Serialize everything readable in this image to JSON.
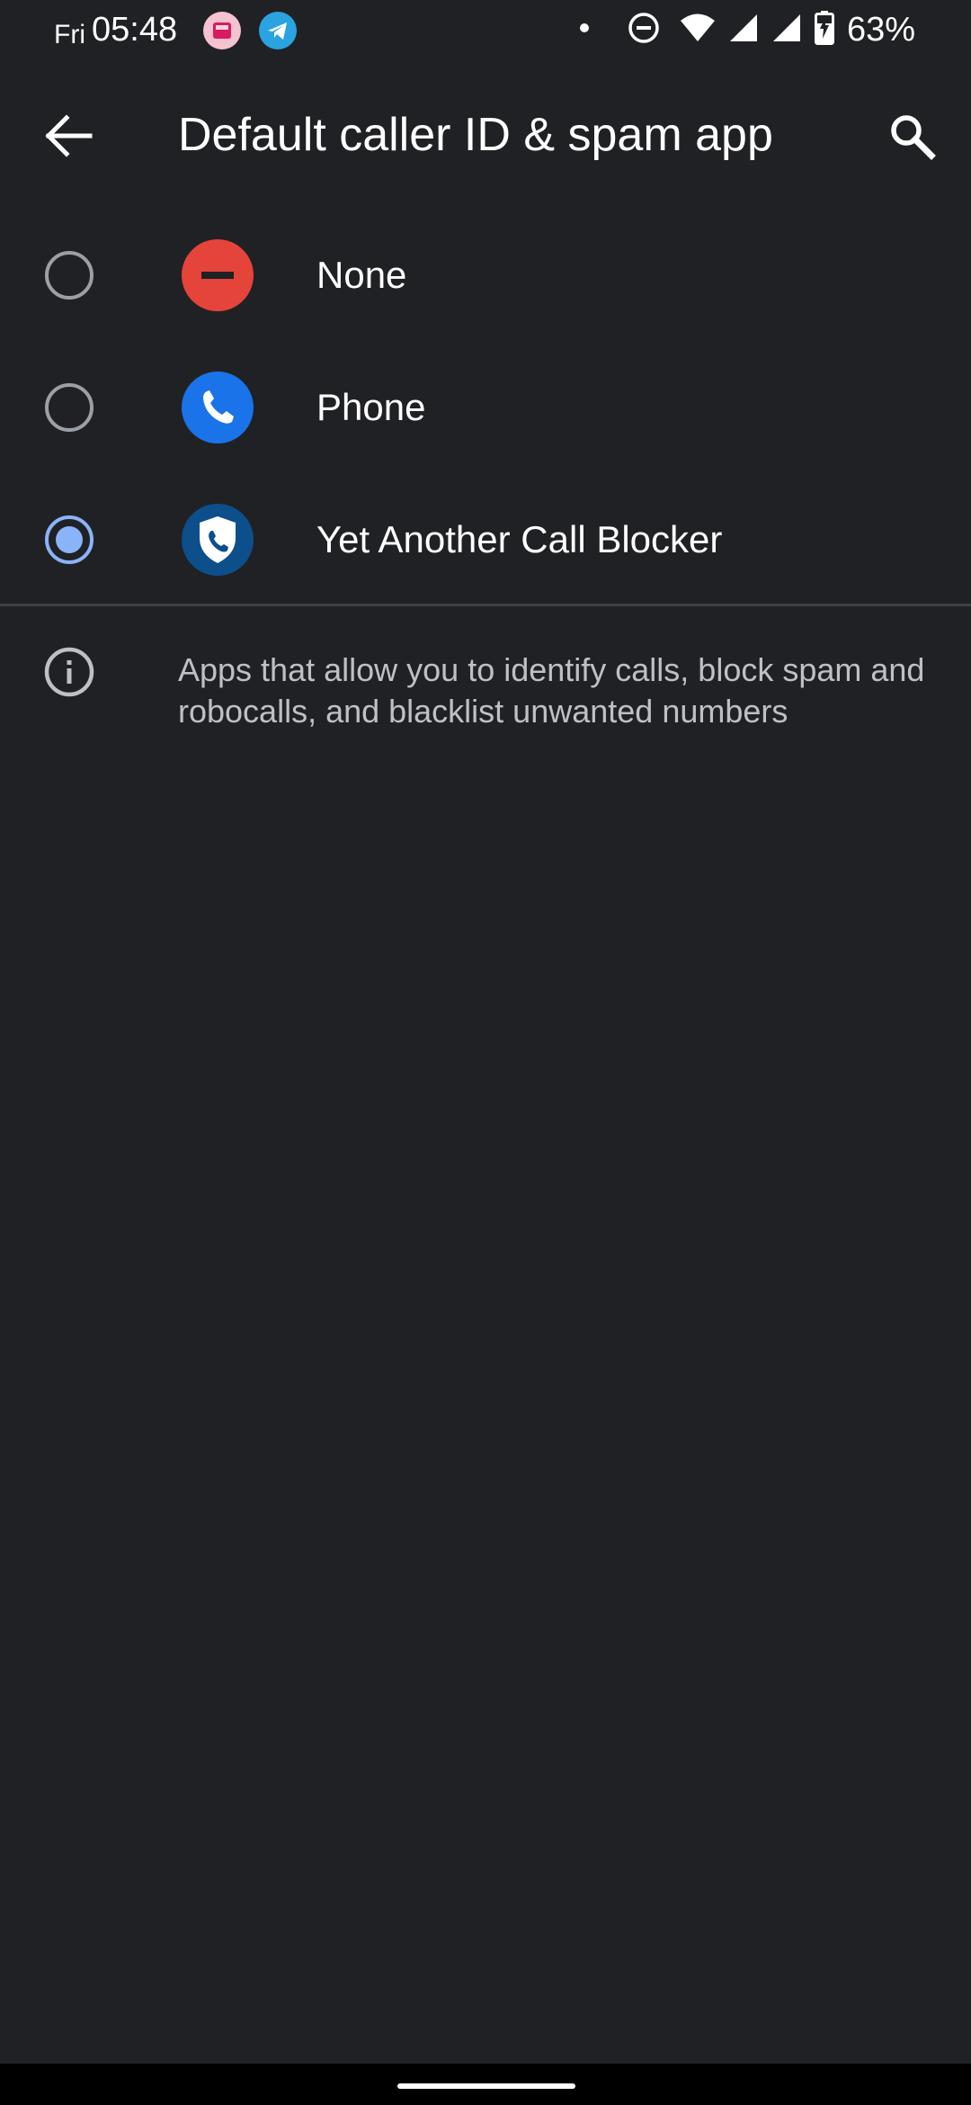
{
  "status_bar": {
    "day": "Fri",
    "time": "05:48",
    "battery": "63%",
    "icons": [
      "notification-app-icon",
      "telegram-icon",
      "dot-icon",
      "dnd-icon",
      "wifi-icon",
      "signal-icon",
      "signal-icon",
      "battery-charging-icon"
    ]
  },
  "app_bar": {
    "title": "Default caller ID & spam app",
    "back_icon": "back-arrow-icon",
    "search_icon": "search-icon"
  },
  "options": [
    {
      "label": "None",
      "selected": false,
      "icon": "none-icon",
      "icon_color": "#e5443a"
    },
    {
      "label": "Phone",
      "selected": false,
      "icon": "phone-app-icon",
      "icon_color": "#1a73e8"
    },
    {
      "label": "Yet Another Call Blocker",
      "selected": true,
      "icon": "call-blocker-shield-icon",
      "icon_color": "#0d4f8b"
    }
  ],
  "info": {
    "icon": "info-icon",
    "text": "Apps that allow you to identify calls, block spam and robocalls, and blacklist unwanted numbers"
  },
  "colors": {
    "background": "#202124",
    "accent": "#8ab4f8",
    "radio_unselected": "#9aa0a6"
  }
}
